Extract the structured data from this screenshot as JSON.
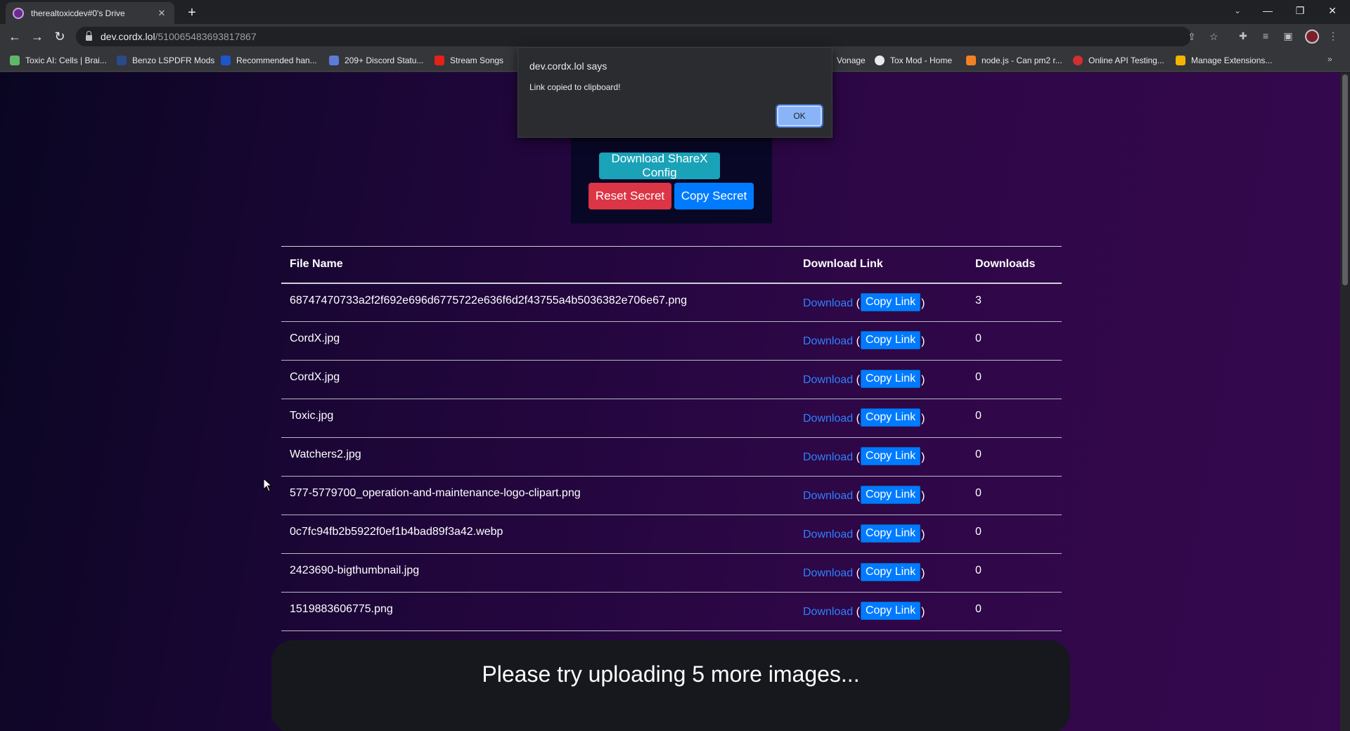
{
  "browser": {
    "tab": {
      "title": "therealtoxicdev#0's Drive",
      "close": "✕"
    },
    "new_tab": "+",
    "window_controls": {
      "tab_search": "⌄",
      "minimize": "—",
      "restore": "❐",
      "close": "✕"
    },
    "nav": {
      "back": "←",
      "forward": "→",
      "reload": "↻"
    },
    "url": {
      "host": "dev.cordx.lol",
      "path": "/510065483693817867"
    },
    "bookmarks": [
      {
        "label": "Toxic AI: Cells | Brai...",
        "color": "#5fb86a"
      },
      {
        "label": "Benzo LSPDFR Mods",
        "color": "#2a4a8a"
      },
      {
        "label": "Recommended han...",
        "color": "#1e56c8"
      },
      {
        "label": "209+ Discord Statu...",
        "color": "#5b7bd6"
      },
      {
        "label": "Stream Songs",
        "color": "#e62117"
      },
      {
        "label": "Vonage",
        "color": "#222222"
      },
      {
        "label": "Tox Mod - Home",
        "color": "#e8eaed"
      },
      {
        "label": "node.js - Can pm2 r...",
        "color": "#f48024"
      },
      {
        "label": "Online API Testing...",
        "color": "#d32f2f"
      },
      {
        "label": "Manage Extensions...",
        "color": "#f4b400"
      }
    ],
    "bookmarks_more": "»"
  },
  "controls": {
    "sharex_config": "Download ShareX Config",
    "reset_secret": "Reset Secret",
    "copy_secret": "Copy Secret"
  },
  "table": {
    "headers": {
      "file_name": "File Name",
      "download_link": "Download Link",
      "downloads": "Downloads"
    },
    "download_label": "Download",
    "copy_link_label": "Copy Link",
    "open_paren": "(",
    "close_paren": ")",
    "rows": [
      {
        "name": "68747470733a2f2f692e696d6775722e636f6d2f43755a4b5036382e706e67.png",
        "downloads": "3"
      },
      {
        "name": "CordX.jpg",
        "downloads": "0"
      },
      {
        "name": "CordX.jpg",
        "downloads": "0"
      },
      {
        "name": "Toxic.jpg",
        "downloads": "0"
      },
      {
        "name": "Watchers2.jpg",
        "downloads": "0"
      },
      {
        "name": "577-5779700_operation-and-maintenance-logo-clipart.png",
        "downloads": "0"
      },
      {
        "name": "0c7fc94fb2b5922f0ef1b4bad89f3a42.webp",
        "downloads": "0"
      },
      {
        "name": "2423690-bigthumbnail.jpg",
        "downloads": "0"
      },
      {
        "name": "1519883606775.png",
        "downloads": "0"
      }
    ]
  },
  "banner": {
    "text": "Please try uploading 5 more images..."
  },
  "dialog": {
    "title": "dev.cordx.lol says",
    "message": "Link copied to clipboard!",
    "ok": "OK"
  },
  "colors": {
    "accent_teal": "#1aa2b8",
    "danger_red": "#dc3545",
    "primary_blue": "#007bff",
    "link_blue": "#2f80ff"
  }
}
